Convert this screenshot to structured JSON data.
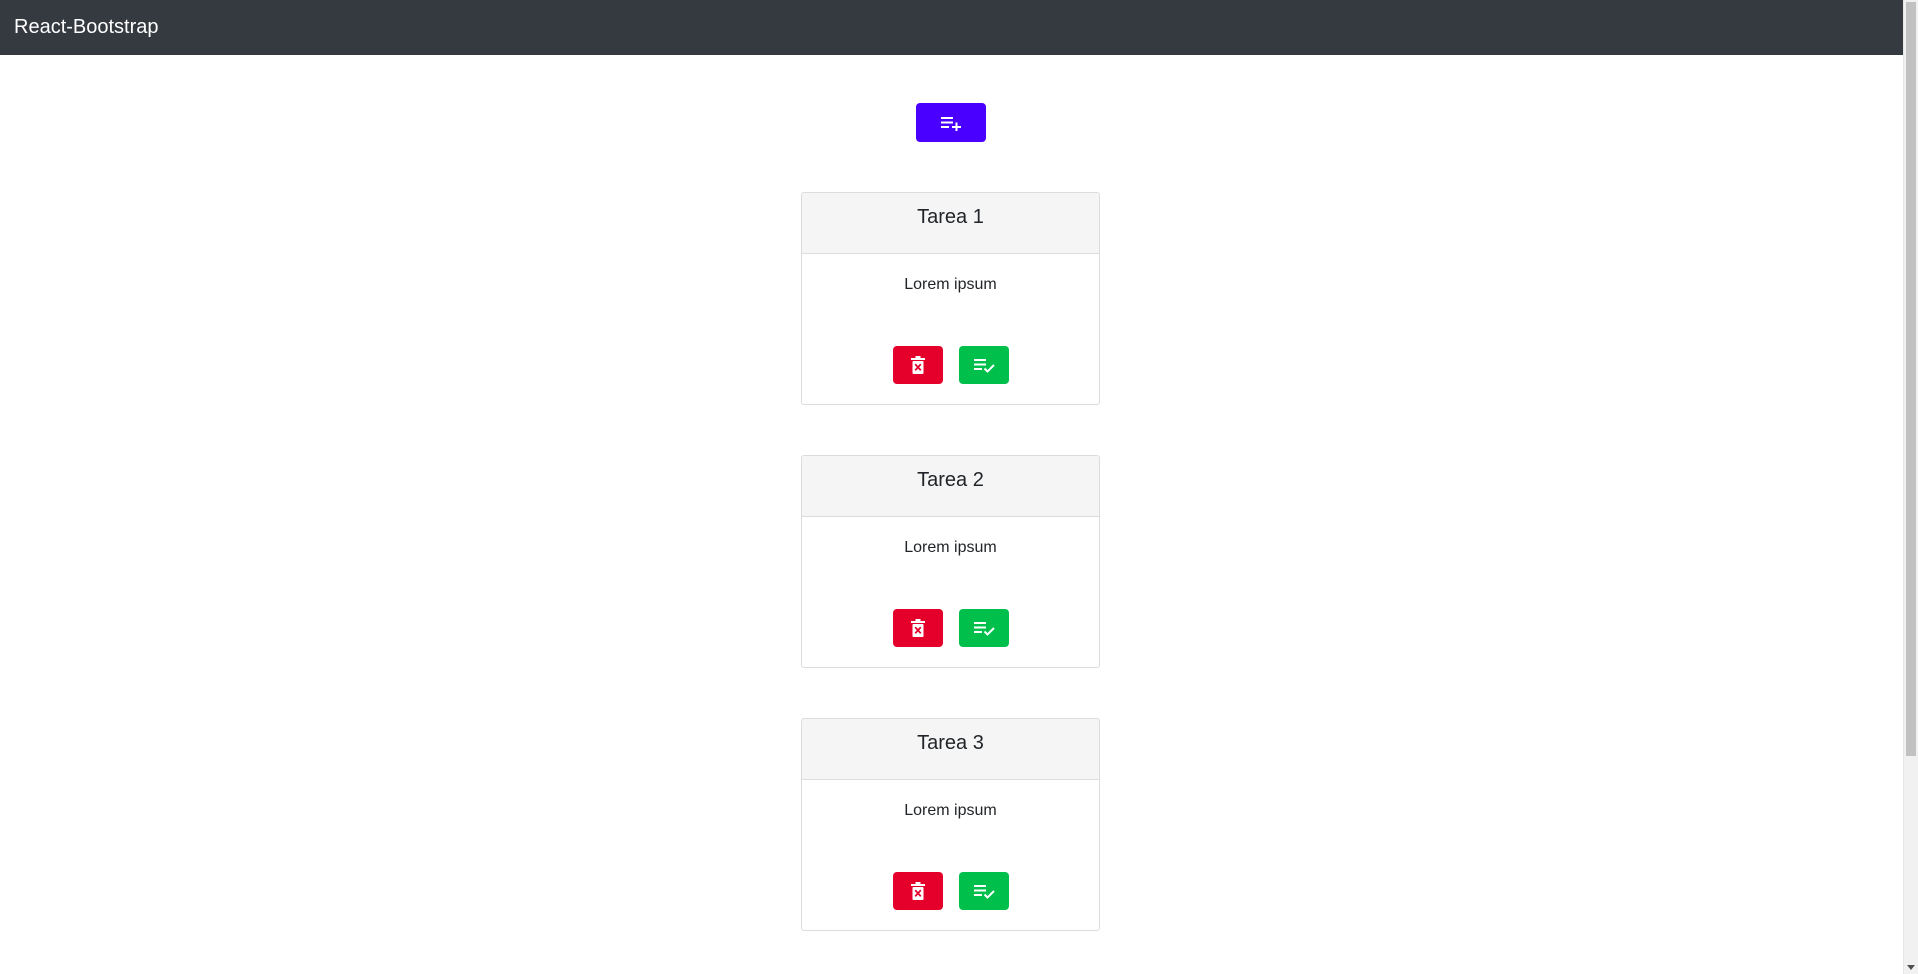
{
  "navbar": {
    "brand": "React-Bootstrap"
  },
  "toolbar": {
    "add_icon": "playlist-add-icon",
    "add_color": "#4a00ff"
  },
  "tasks": [
    {
      "title": "Tarea 1",
      "description": "Lorem ipsum"
    },
    {
      "title": "Tarea 2",
      "description": "Lorem ipsum"
    },
    {
      "title": "Tarea 3",
      "description": "Lorem ipsum"
    }
  ],
  "icons": {
    "delete": "trash-x-icon",
    "complete": "playlist-check-icon"
  },
  "colors": {
    "navbar": "#343a40",
    "delete": "#e4002b",
    "complete": "#00c04b"
  }
}
